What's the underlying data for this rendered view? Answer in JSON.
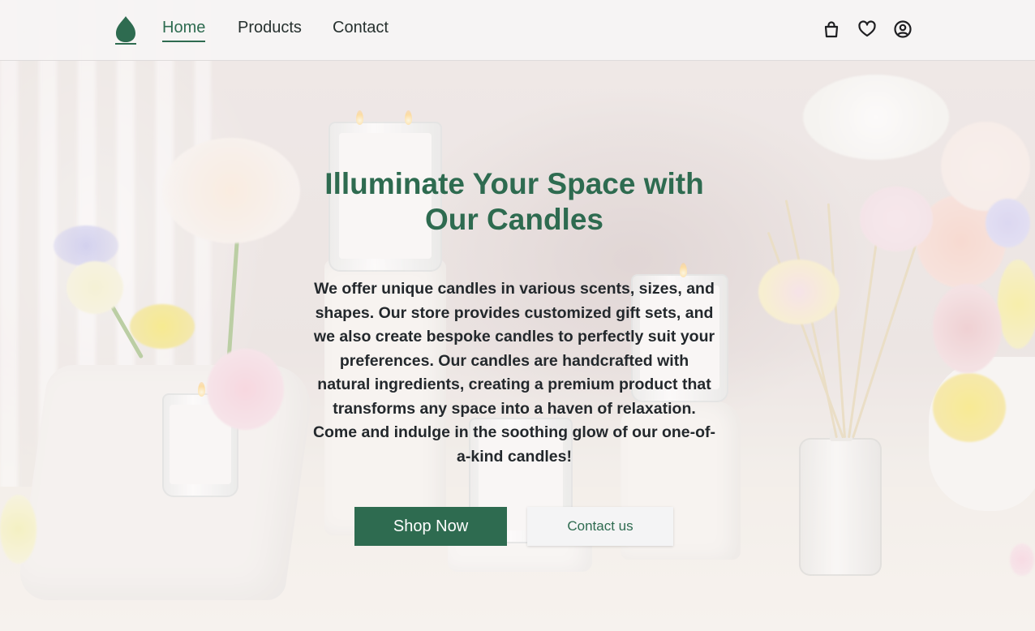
{
  "nav": {
    "logo_icon": "leaf-drop-icon",
    "links": [
      {
        "label": "Home",
        "active": true
      },
      {
        "label": "Products",
        "active": false
      },
      {
        "label": "Contact",
        "active": false
      }
    ],
    "icons": [
      "shopping-bag-icon",
      "heart-icon",
      "user-circle-icon"
    ]
  },
  "hero": {
    "title": "Illuminate Your Space with Our Candles",
    "text": "We offer unique candles in various scents, sizes, and shapes. Our store provides customized gift sets, and we also create bespoke candles to perfectly suit your preferences. Our candles are handcrafted with natural ingredients, creating a premium product that transforms any space into a haven of relaxation. Come and indulge in the soothing glow of our one-of-a-kind candles!",
    "primary_button": "Shop Now",
    "secondary_button": "Contact us"
  },
  "colors": {
    "accent": "#2e6b50",
    "text": "#23282c",
    "header_bg": "#f6f4f4"
  }
}
